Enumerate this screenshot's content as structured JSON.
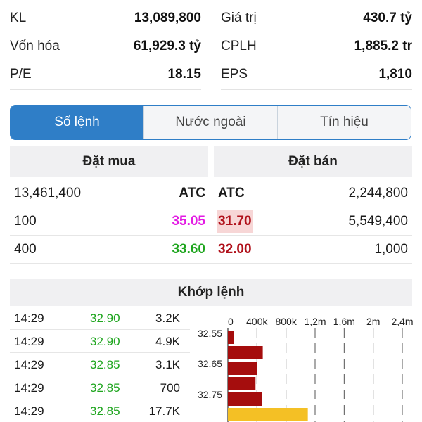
{
  "stats": {
    "left": [
      {
        "label": "KL",
        "value": "13,089,800"
      },
      {
        "label": "Vốn hóa",
        "value": "61,929.3 tỷ"
      },
      {
        "label": "P/E",
        "value": "18.15"
      }
    ],
    "right": [
      {
        "label": "Giá trị",
        "value": "430.7 tỷ"
      },
      {
        "label": "CPLH",
        "value": "1,885.2 tr"
      },
      {
        "label": "EPS",
        "value": "1,810"
      }
    ]
  },
  "tabs": [
    "Sổ lệnh",
    "Nước ngoài",
    "Tín hiệu"
  ],
  "order_book": {
    "buy_header": "Đặt mua",
    "sell_header": "Đặt bán",
    "rows": [
      {
        "buy_vol": "13,461,400",
        "buy_price": "ATC",
        "sell_price": "ATC",
        "sell_vol": "2,244,800",
        "buy_color": "#1a1a1a",
        "sell_color": "#1a1a1a"
      },
      {
        "buy_vol": "100",
        "buy_price": "35.05",
        "sell_price": "31.70",
        "sell_vol": "5,549,400",
        "buy_color": "#e31be3",
        "sell_color": "#b0101a"
      },
      {
        "buy_vol": "400",
        "buy_price": "33.60",
        "sell_price": "32.00",
        "sell_vol": "1,000",
        "buy_color": "#1ea51e",
        "sell_color": "#b0101a"
      }
    ]
  },
  "matched": {
    "title": "Khớp lệnh",
    "trades": [
      {
        "time": "14:29",
        "price": "32.90",
        "vol": "3.2K"
      },
      {
        "time": "14:29",
        "price": "32.90",
        "vol": "4.9K"
      },
      {
        "time": "14:29",
        "price": "32.85",
        "vol": "3.1K"
      },
      {
        "time": "14:29",
        "price": "32.85",
        "vol": "700"
      },
      {
        "time": "14:29",
        "price": "32.85",
        "vol": "17.7K"
      }
    ]
  },
  "chart_data": {
    "type": "bar",
    "orientation": "horizontal",
    "x_ticks": [
      "0",
      "400k",
      "800k",
      "1,2m",
      "1,6m",
      "2m",
      "2,4m"
    ],
    "y_ticks": [
      "32.55",
      "32.65",
      "32.75"
    ],
    "xlim": [
      0,
      2400000
    ],
    "bars": [
      {
        "value": 80000,
        "color": "#a50d0d"
      },
      {
        "value": 480000,
        "color": "#a50d0d"
      },
      {
        "value": 400000,
        "color": "#a50d0d"
      },
      {
        "value": 380000,
        "color": "#a50d0d"
      },
      {
        "value": 470000,
        "color": "#a50d0d"
      },
      {
        "value": 1100000,
        "color": "#f4c025"
      }
    ]
  }
}
